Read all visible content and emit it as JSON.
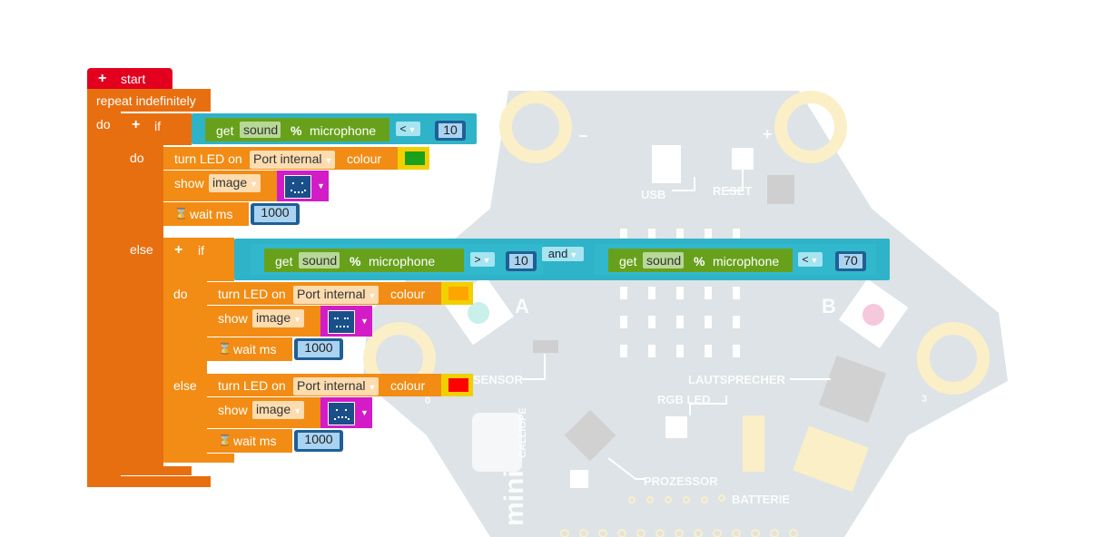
{
  "board": {
    "labels": {
      "minus": "−",
      "plus": "+",
      "usb": "USB",
      "reset": "RESET",
      "a": "A",
      "b": "B",
      "sensor": "SENSOR",
      "lautsprecher": "LAUTSPRECHER",
      "rgb_led": "RGB LED",
      "prozessor": "PROZESSOR",
      "batterie": "BATTERIE",
      "pin0": "0",
      "pin3": "3",
      "brand": "CALLIOPE",
      "model": "mini"
    }
  },
  "blocks": {
    "start": {
      "plus": "+",
      "label": "start"
    },
    "repeat": {
      "label": "repeat indefinitely",
      "do": "do"
    },
    "if1": {
      "plus": "+",
      "if": "if",
      "cond": {
        "get": "get",
        "sound": "sound",
        "pct": "%",
        "mic": "microphone",
        "op": "<",
        "value": "10"
      },
      "do": "do",
      "led": {
        "label": "turn LED on",
        "port": "Port internal",
        "colour_label": "colour",
        "colour": "#1aa01a"
      },
      "show": {
        "label": "show",
        "image": "image"
      },
      "wait": {
        "icon": "⌛",
        "label": "wait ms",
        "value": "1000"
      }
    },
    "else1": "else",
    "if2": {
      "plus": "+",
      "if": "if",
      "cond1": {
        "get": "get",
        "sound": "sound",
        "pct": "%",
        "mic": "microphone",
        "op": ">",
        "value": "10"
      },
      "and": "and",
      "cond2": {
        "get": "get",
        "sound": "sound",
        "pct": "%",
        "mic": "microphone",
        "op": "<",
        "value": "70"
      },
      "do": "do",
      "led": {
        "label": "turn LED on",
        "port": "Port internal",
        "colour_label": "colour",
        "colour": "#ffa500"
      },
      "show": {
        "label": "show",
        "image": "image"
      },
      "wait": {
        "icon": "⌛",
        "label": "wait ms",
        "value": "1000"
      },
      "else": "else",
      "led2": {
        "label": "turn LED on",
        "port": "Port internal",
        "colour_label": "colour",
        "colour": "#ff0000"
      },
      "show2": {
        "label": "show",
        "image": "image"
      },
      "wait2": {
        "icon": "⌛",
        "label": "wait ms",
        "value": "1000"
      }
    }
  }
}
